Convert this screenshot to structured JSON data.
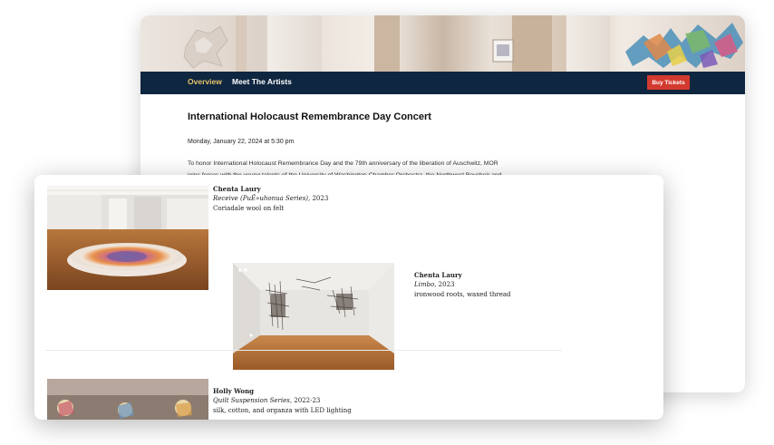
{
  "nav": {
    "overview": "Overview",
    "meet_artists": "Meet The Artists",
    "buy_tickets": "Buy Tickets"
  },
  "event": {
    "title": "International Holocaust Remembrance Day Concert",
    "date": "Monday, January 22, 2024 at 5:30 pm",
    "description_line1": "To honor International Holocaust Remembrance Day and the 79th anniversary of the liberation of Auschwitz, MOR",
    "description_line2": "joins forces with the young talents of the University of Washington Chamber Orchestra, the Northwest Boychoir and"
  },
  "artworks": [
    {
      "artist": "Chenta Laury",
      "title": "Receive (PuĚ»uhonua Series)",
      "year": ", 2023",
      "medium": "Coriadale wool on felt"
    },
    {
      "artist": "Chenta Laury",
      "title": "Limbo",
      "year": ", 2023",
      "medium": "ironwood roots, waxed thread"
    },
    {
      "artist": "Holly Wong",
      "title": "Quilt Suspension Series",
      "year": ", 2022-23",
      "medium": "silk, cotton, and organza with LED lighting"
    }
  ],
  "colors": {
    "nav_bg": "#0f2640",
    "nav_active": "#e6c36b",
    "buy_button": "#d33a2f"
  }
}
